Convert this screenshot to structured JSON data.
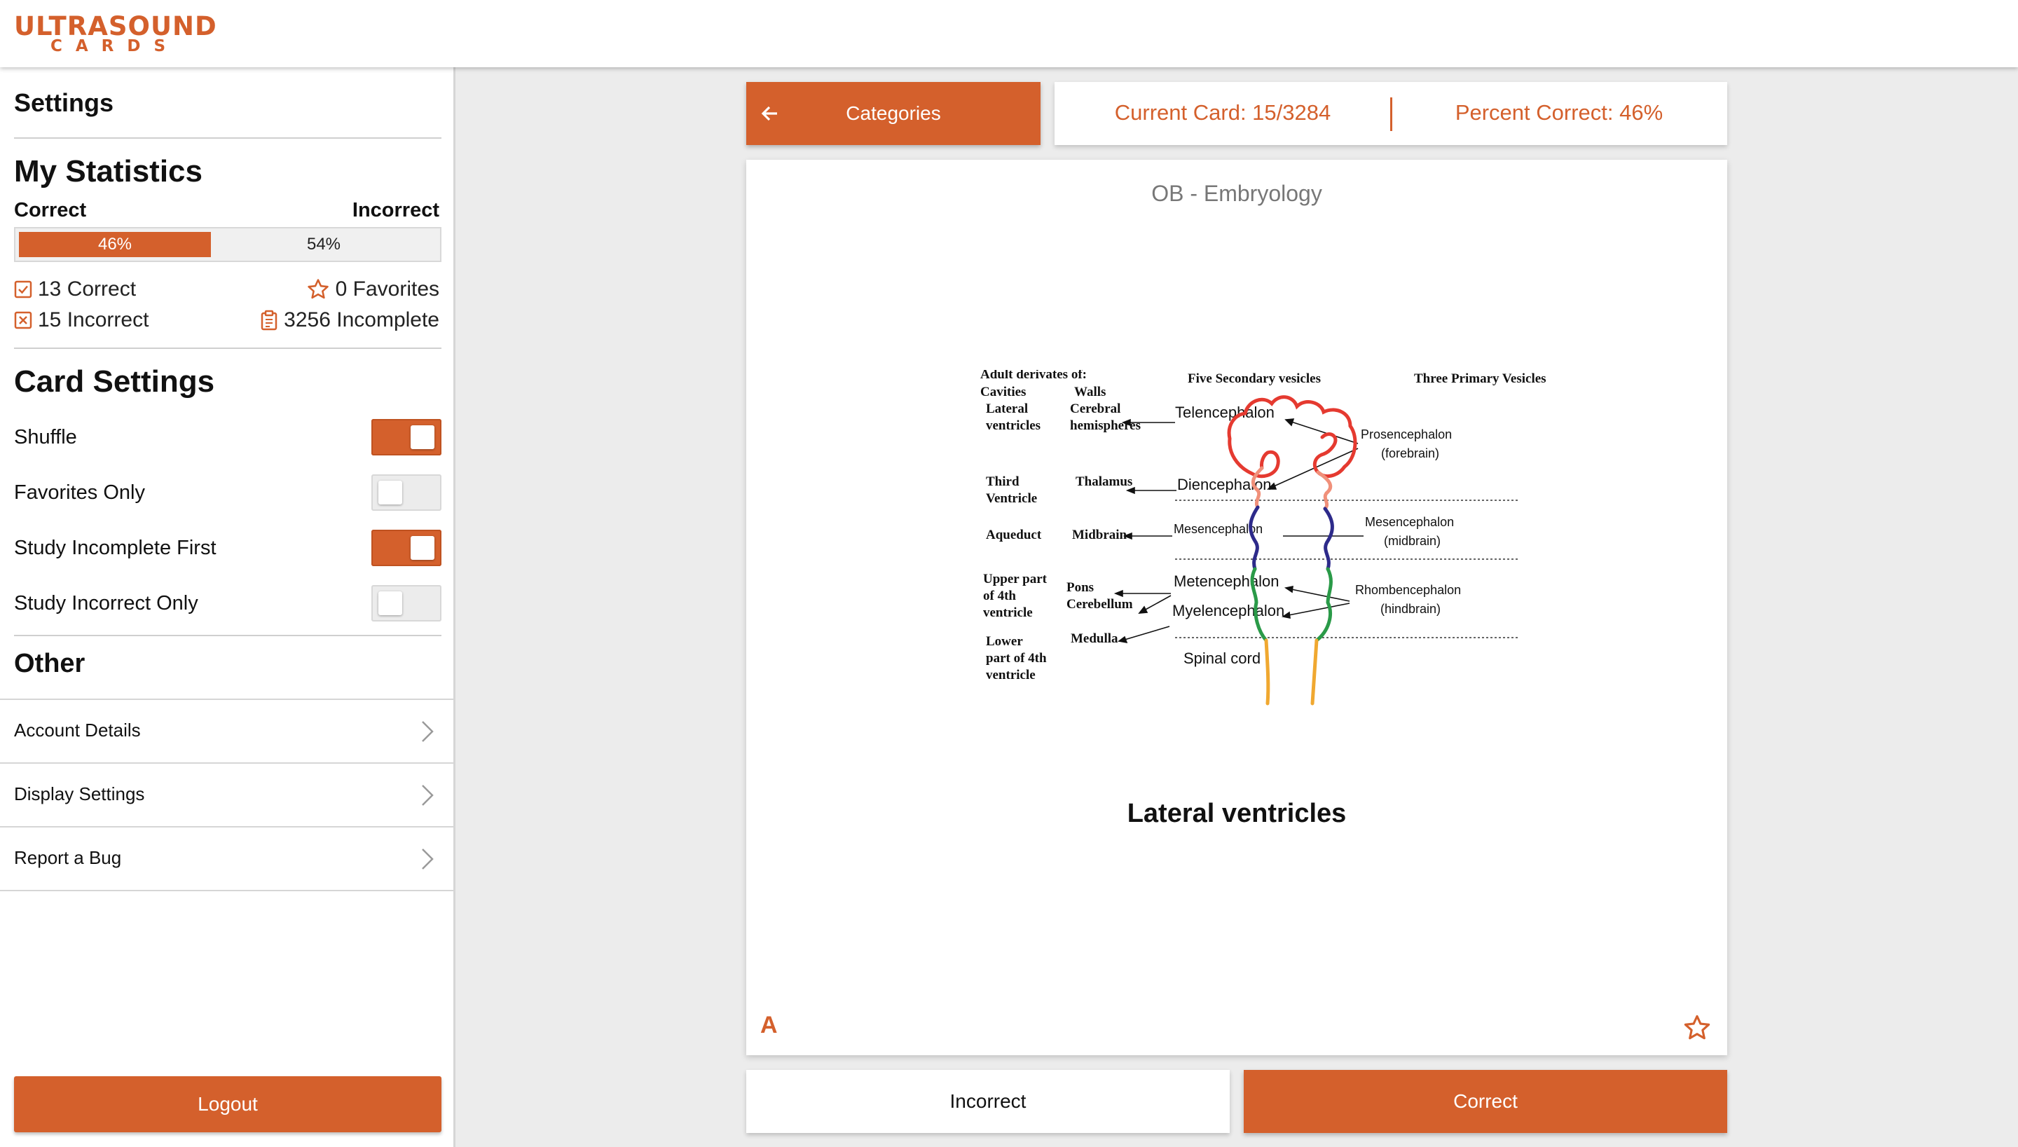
{
  "app": {
    "logo_top": "ULTRASOUND",
    "logo_bottom": "CARDS",
    "accent_color": "#d4602c"
  },
  "sidebar": {
    "settings_title": "Settings",
    "statistics": {
      "title": "My Statistics",
      "correct_label": "Correct",
      "incorrect_label": "Incorrect",
      "correct_percent": 46,
      "correct_percent_text": "46%",
      "incorrect_percent_text": "54%",
      "correct_count": "13 Correct",
      "incorrect_count": "15 Incorrect",
      "favorites_count": "0 Favorites",
      "incomplete_count": "3256 Incomplete"
    },
    "card_settings": {
      "title": "Card Settings",
      "toggles": [
        {
          "label": "Shuffle",
          "on": true
        },
        {
          "label": "Favorites Only",
          "on": false
        },
        {
          "label": "Study Incomplete First",
          "on": true
        },
        {
          "label": "Study Incorrect Only",
          "on": false
        }
      ]
    },
    "other": {
      "title": "Other",
      "items": [
        "Account Details",
        "Display Settings",
        "Report a Bug"
      ]
    },
    "logout_label": "Logout"
  },
  "toolbar": {
    "categories_label": "Categories",
    "current_card": "Current Card: 15/3284",
    "percent_correct": "Percent Correct: 46%"
  },
  "card": {
    "category": "OB - Embryology",
    "answer": "Lateral ventricles",
    "side_letter": "A",
    "diagram": {
      "header_adult": "Adult derivates of:",
      "header_cavities": "Cavities",
      "header_walls": "Walls",
      "header_secondary": "Five Secondary vesicles",
      "header_primary": "Three Primary Vesicles",
      "cav1a": "Lateral",
      "cav1b": "ventricles",
      "cav2a": "Third",
      "cav2b": "Ventricle",
      "cav3": "Aqueduct",
      "cav4a": "Upper part",
      "cav4b": "of 4th",
      "cav4c": "ventricle",
      "cav5a": "Lower",
      "cav5b": "part of 4th",
      "cav5c": "ventricle",
      "wall1a": "Cerebral",
      "wall1b": "hemispheres",
      "wall2": "Thalamus",
      "wall3": "Midbrain",
      "wall4a": "Pons",
      "wall4b": "Cerebellum",
      "wall5": "Medulla",
      "sec1": "Telencephalon",
      "sec2": "Diencephalon",
      "sec3": "Mesencephalon",
      "sec4": "Metencephalon",
      "sec5": "Myelencephalon",
      "spinal": "Spinal cord",
      "pri1a": "Prosencephalon",
      "pri1b": "(forebrain)",
      "pri2a": "Mesencephalon",
      "pri2b": "(midbrain)",
      "pri3a": "Rhombencephalon",
      "pri3b": "(hindbrain)"
    }
  },
  "actions": {
    "incorrect_label": "Incorrect",
    "correct_label": "Correct"
  },
  "icons": {
    "back": "arrow-left-icon",
    "check": "checkbox-check-icon",
    "x": "checkbox-x-icon",
    "star": "star-outline-icon",
    "clipboard": "clipboard-icon",
    "chevron": "chevron-right-icon"
  }
}
